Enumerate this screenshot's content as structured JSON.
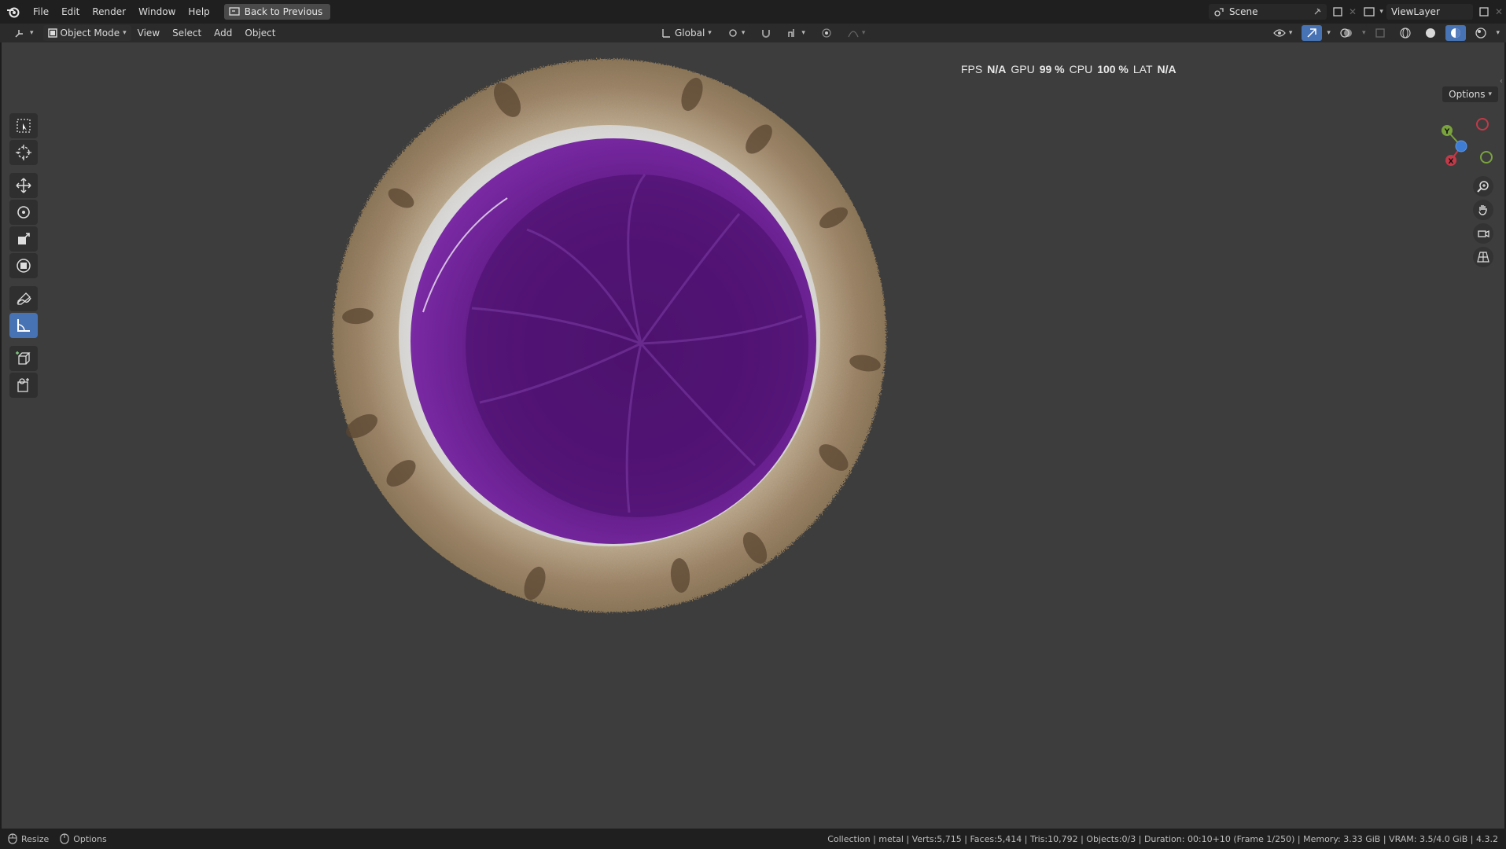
{
  "topbar": {
    "menus": [
      "File",
      "Edit",
      "Render",
      "Window",
      "Help"
    ],
    "back_button": "Back to Previous",
    "scene_name": "Scene",
    "view_layer_name": "ViewLayer"
  },
  "header": {
    "mode": "Object Mode",
    "menus": [
      "View",
      "Select",
      "Add",
      "Object"
    ],
    "transform_orientation": "Global"
  },
  "stats": {
    "fps_label": "FPS",
    "fps_value": "N/A",
    "gpu_label": "GPU",
    "gpu_value": "99 %",
    "cpu_label": "CPU",
    "cpu_value": "100 %",
    "lat_label": "LAT",
    "lat_value": "N/A"
  },
  "viewport": {
    "options_label": "Options",
    "gizmo_axes": [
      "Y",
      "X"
    ],
    "object_colors": {
      "fur": "#9b8264",
      "inner": "#6a1f8f",
      "inner_dark": "#3d0d57",
      "rim_white": "#dcdcdc"
    }
  },
  "statusbar": {
    "left_items": [
      "Resize",
      "Options"
    ],
    "info": "Collection | metal | Verts:5,715 | Faces:5,414 | Tris:10,792 | Objects:0/3 | Duration: 00:10+10 (Frame 1/250) | Memory: 3.33 GiB | VRAM: 3.5/4.0 GiB | 4.3.2"
  },
  "icons": {
    "logo": "blender-logo-icon",
    "tools": [
      "select-box-icon",
      "cursor-icon",
      "move-icon",
      "rotate-icon",
      "scale-icon",
      "transform-icon",
      "annotate-icon",
      "measure-icon",
      "add-cube-icon",
      "add-object-icon"
    ],
    "nav": [
      "zoom-icon",
      "pan-hand-icon",
      "camera-icon",
      "grid-icon"
    ]
  }
}
